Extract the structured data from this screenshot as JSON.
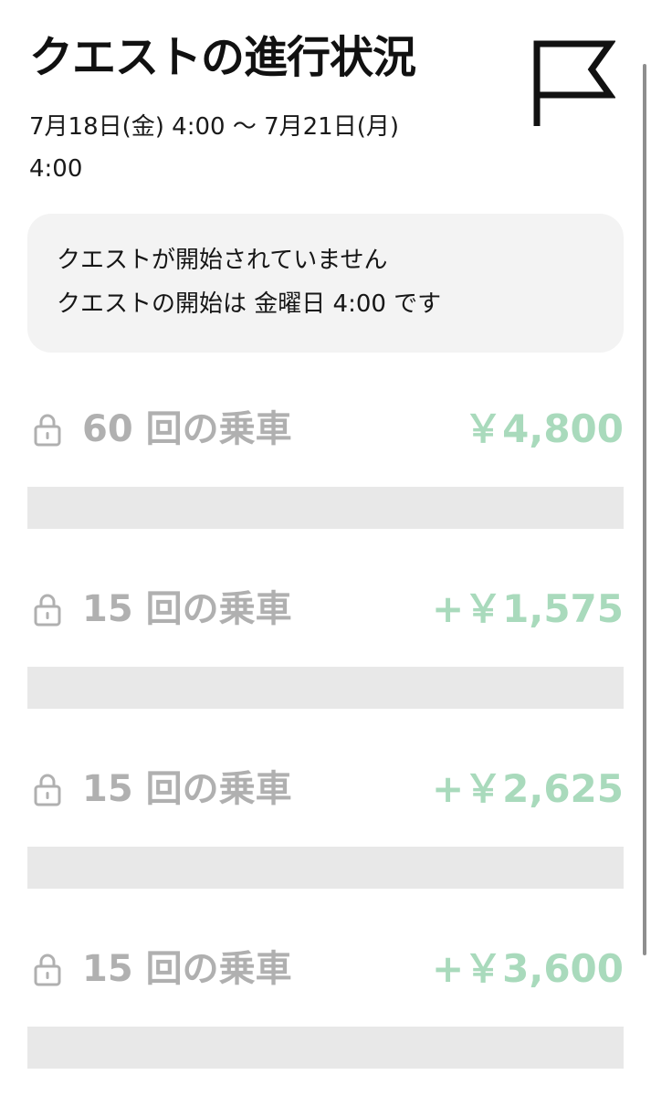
{
  "header": {
    "title": "クエストの進行状況",
    "date_range": "7月18日(金) 4:00 〜 7月21日(月) 4:00",
    "flag_icon": "flag-icon"
  },
  "notice": {
    "line1": "クエストが開始されていません",
    "line2": "クエストの開始は 金曜日 4:00 です"
  },
  "quests": [
    {
      "label": "60 回の乗車",
      "reward": "￥4,800",
      "progress": 0,
      "locked": true,
      "icon": "lock-icon"
    },
    {
      "label": "15 回の乗車",
      "reward": "+￥1,575",
      "progress": 0,
      "locked": true,
      "icon": "lock-icon"
    },
    {
      "label": "15 回の乗車",
      "reward": "+￥2,625",
      "progress": 0,
      "locked": true,
      "icon": "lock-icon"
    },
    {
      "label": "15 回の乗車",
      "reward": "+￥3,600",
      "progress": 0,
      "locked": true,
      "icon": "lock-icon"
    }
  ],
  "colors": {
    "label_gray": "#b0b0b0",
    "reward_green": "#a9dabc",
    "bar_track": "#e8e8e8",
    "card_bg": "#f3f3f3"
  }
}
